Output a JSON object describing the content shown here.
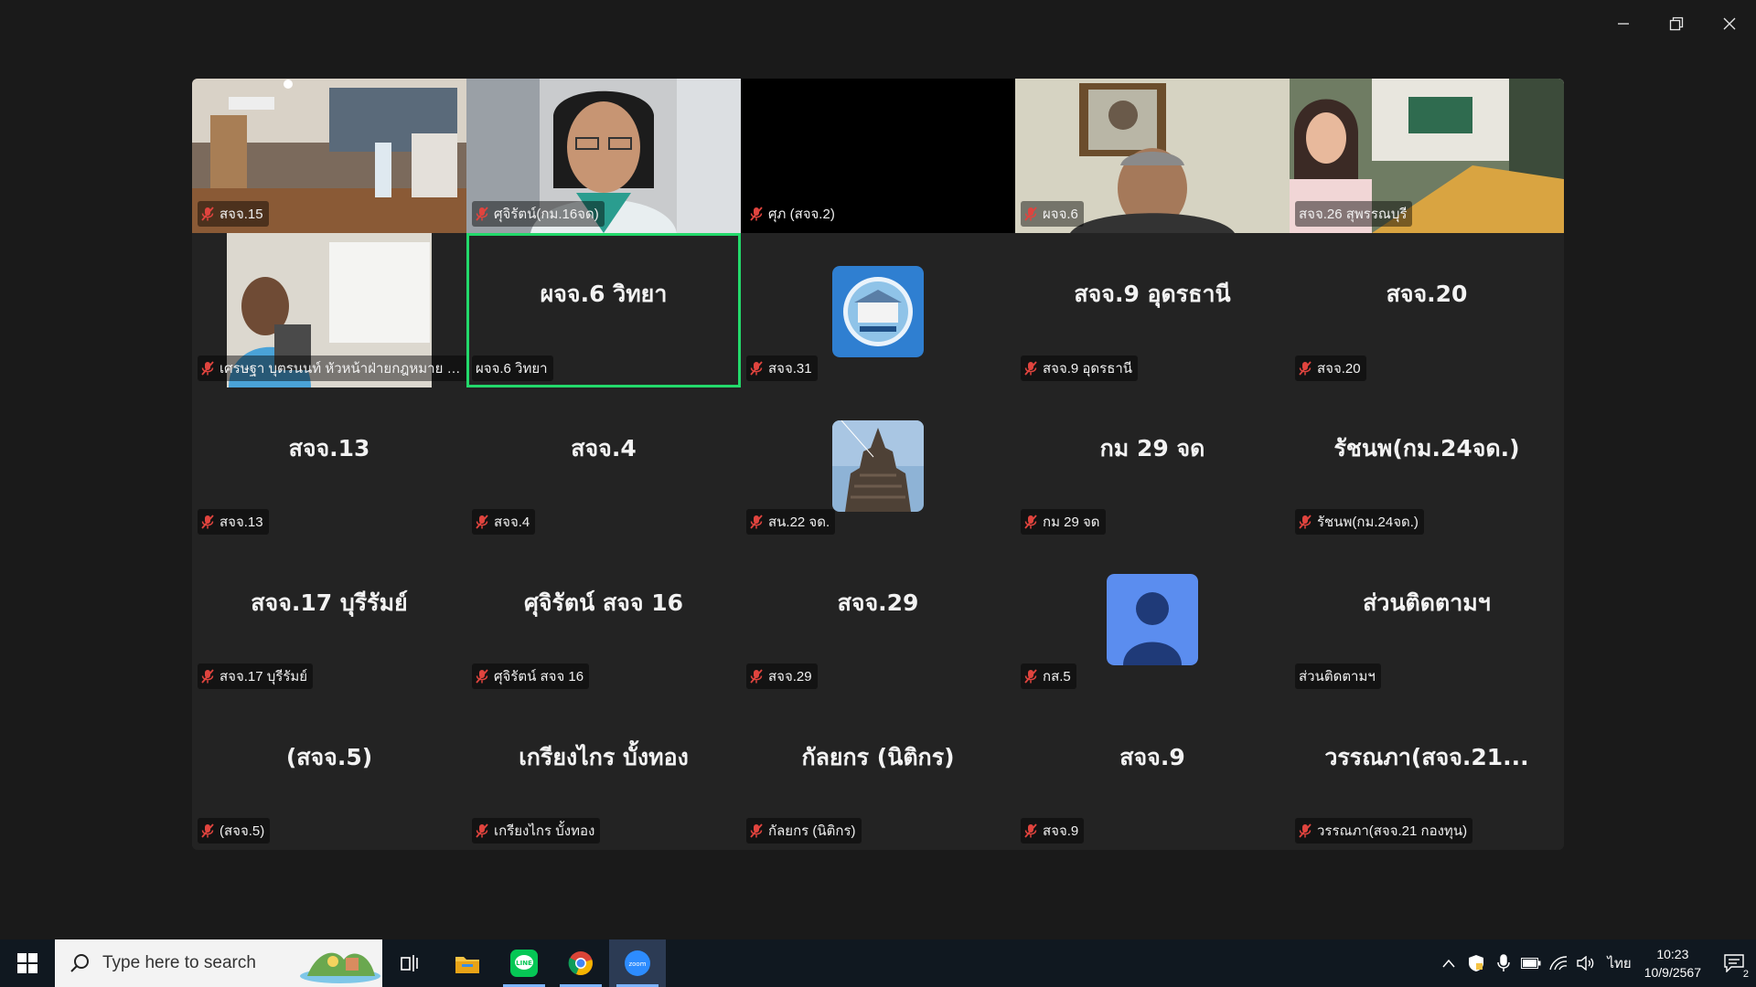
{
  "window": {
    "controls": [
      "minimize-icon",
      "restore-icon",
      "close-icon"
    ]
  },
  "colors": {
    "active_speaker": "#23d96b",
    "tile_bg": "#232323",
    "page_bg": "#1a1a1a",
    "mic_muted": "#e0443e",
    "avatar_blue": "#5b8def"
  },
  "gallery": {
    "tiles": [
      {
        "label": "สจจ.15",
        "kind": "video",
        "muted": true
      },
      {
        "label": "ศุจิรัตน์(กม.16จด)",
        "kind": "video",
        "muted": true
      },
      {
        "label": "ศุภ (สจจ.2)",
        "kind": "black",
        "muted": true
      },
      {
        "label": "ผจจ.6",
        "kind": "video",
        "muted": true
      },
      {
        "label": "สจจ.26 สุพรรณบุรี",
        "kind": "video",
        "muted": false
      },
      {
        "label": "เศรษฐา บุตรนนท์ หัวหน้าฝ่ายกฎหมาย จัดรู...",
        "kind": "video",
        "muted": true
      },
      {
        "label": "ผจจ.6 วิทยา",
        "big": "ผจจ.6 วิทยา",
        "kind": "name",
        "muted": false,
        "active": true
      },
      {
        "label": "สจจ.31",
        "kind": "image",
        "muted": true
      },
      {
        "label": "สจจ.9 อุดรธานี",
        "big": "สจจ.9 อุดรธานี",
        "kind": "name",
        "muted": true
      },
      {
        "label": "สจจ.20",
        "big": "สจจ.20",
        "kind": "name",
        "muted": true
      },
      {
        "label": "สจจ.13",
        "big": "สจจ.13",
        "kind": "name",
        "muted": true
      },
      {
        "label": "สจจ.4",
        "big": "สจจ.4",
        "kind": "name",
        "muted": true
      },
      {
        "label": "สน.22 จด.",
        "kind": "image",
        "muted": true
      },
      {
        "label": "กม 29 จด",
        "big": "กม 29 จด",
        "kind": "name",
        "muted": true
      },
      {
        "label": "รัชนพ(กม.24จด.)",
        "big": "รัชนพ(กม.24จด.)",
        "kind": "name",
        "muted": true
      },
      {
        "label": "สจจ.17 บุรีรัมย์",
        "big": "สจจ.17 บุรีรัมย์",
        "kind": "name",
        "muted": true
      },
      {
        "label": "ศุจิรัตน์ สจจ 16",
        "big": "ศุจิรัตน์ สจจ 16",
        "kind": "name",
        "muted": true
      },
      {
        "label": "สจจ.29",
        "big": "สจจ.29",
        "kind": "name",
        "muted": true
      },
      {
        "label": "กส.5",
        "kind": "avatar",
        "muted": true
      },
      {
        "label": "ส่วนติดตามฯ",
        "big": "ส่วนติดตามฯ",
        "kind": "name",
        "muted": false
      },
      {
        "label": "(สจจ.5)",
        "big": "(สจจ.5)",
        "kind": "name",
        "muted": true
      },
      {
        "label": "เกรียงไกร บั้งทอง",
        "big": "เกรียงไกร บั้งทอง",
        "kind": "name",
        "muted": true
      },
      {
        "label": "กัลยกร (นิติกร)",
        "big": "กัลยกร (นิติกร)",
        "kind": "name",
        "muted": true
      },
      {
        "label": "สจจ.9",
        "big": "สจจ.9",
        "kind": "name",
        "muted": true
      },
      {
        "label": "วรรณภา(สจจ.21 กองทุน)",
        "big": "วรรณภา(สจจ.21...",
        "kind": "name",
        "muted": true
      }
    ]
  },
  "taskbar": {
    "search_placeholder": "Type here to search",
    "apps": [
      "task-view-icon",
      "file-explorer-icon",
      "line-app-icon",
      "chrome-icon",
      "zoom-app-icon"
    ],
    "language": "ไทย",
    "time": "10:23",
    "date": "10/9/2567",
    "notification_count": "2"
  }
}
